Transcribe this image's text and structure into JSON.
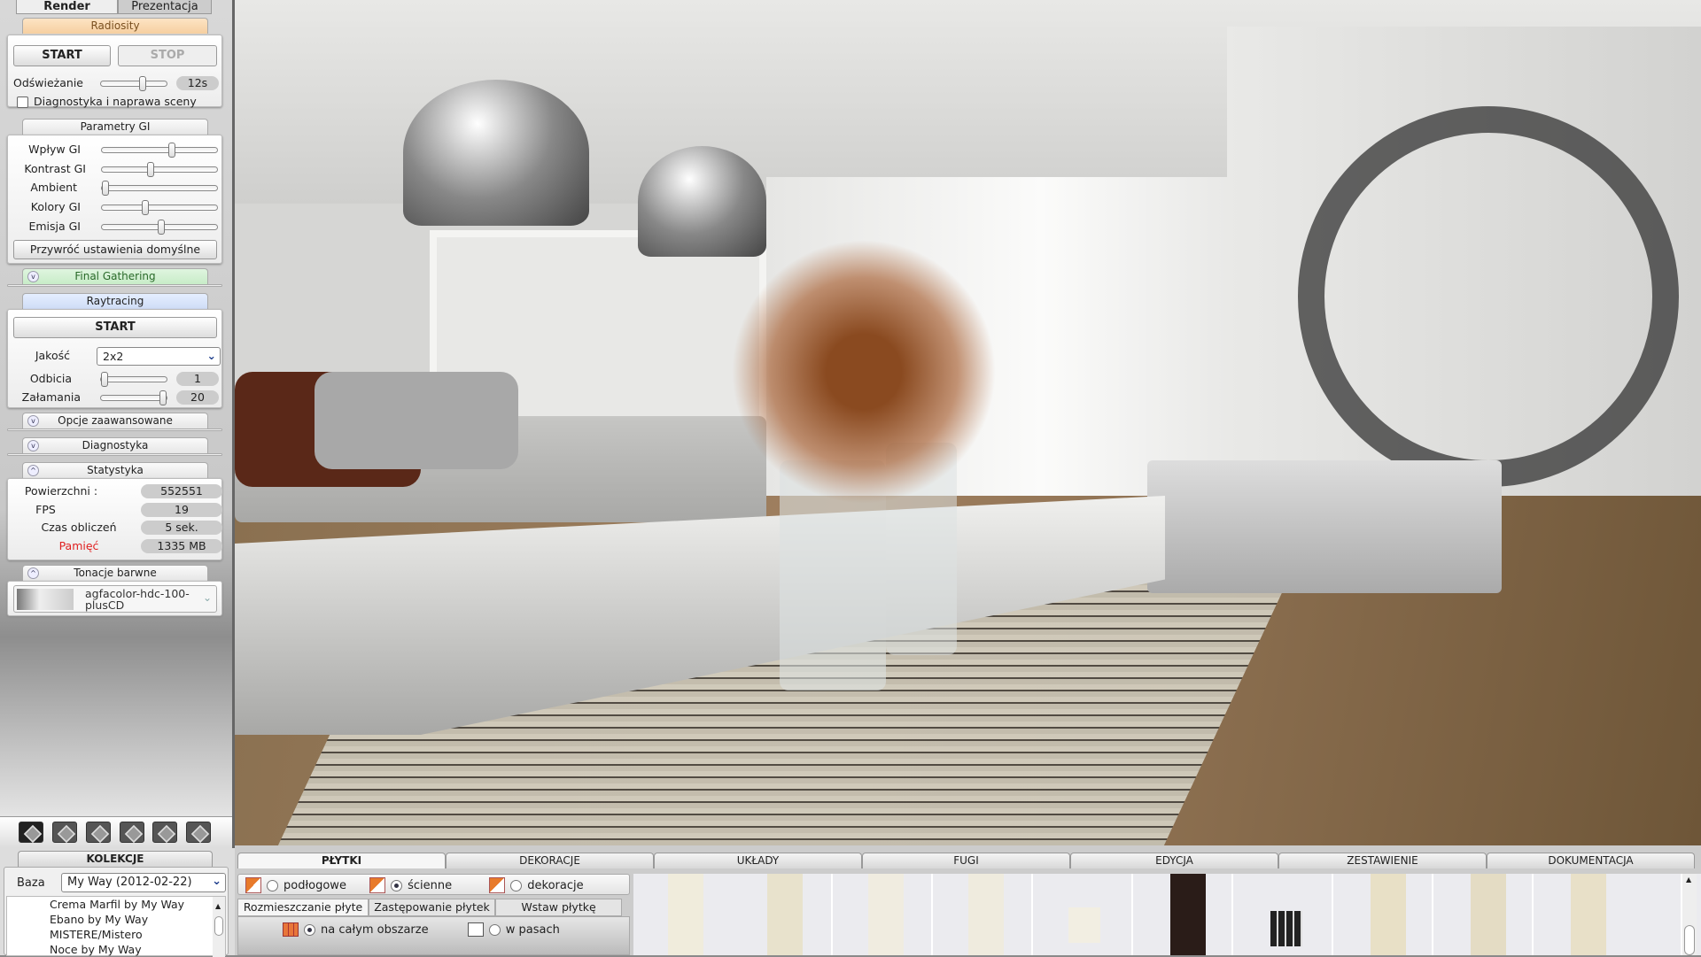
{
  "left_panel": {
    "tabs": [
      "Render",
      "Prezentacja"
    ],
    "radiosity": {
      "header": "Radiosity",
      "start": "START",
      "stop": "STOP",
      "refresh_label": "Odświeżanie",
      "refresh_value": "12s",
      "refresh_level": 0.6,
      "diag_checkbox": "Diagnostyka i naprawa sceny",
      "diag_checked": false
    },
    "gi": {
      "header": "Parametry GI",
      "sliders": [
        {
          "label": "Wpływ GI",
          "level": 0.6
        },
        {
          "label": "Kontrast GI",
          "level": 0.42
        },
        {
          "label": "Ambient",
          "level": 0.0
        },
        {
          "label": "Kolory GI",
          "level": 0.37
        },
        {
          "label": "Emisja GI",
          "level": 0.5
        }
      ],
      "restore": "Przywróć ustawienia domyślne"
    },
    "final_gathering": "Final Gathering",
    "raytracing": {
      "header": "Raytracing",
      "start": "START",
      "quality_label": "Jakość",
      "quality_value": "2x2",
      "reflections_label": "Odbicia",
      "reflections_value": "1",
      "reflections_level": 0.0,
      "refractions_label": "Załamania",
      "refractions_value": "20",
      "refractions_level": 1.0
    },
    "advanced": "Opcje zaawansowane",
    "diagnostics": "Diagnostyka",
    "stats": {
      "header": "Statystyka",
      "rows": [
        {
          "label": "Powierzchni :",
          "value": "552551"
        },
        {
          "label": "FPS",
          "value": "19"
        },
        {
          "label": "Czas obliczeń",
          "value": "5 sek."
        },
        {
          "label": "Pamięć",
          "value": "1335 MB"
        }
      ],
      "warn_color": "#e02020"
    },
    "tone": {
      "header": "Tonacje barwne",
      "value": "agfacolor-hdc-100-plusCD"
    },
    "view_icons": [
      "refresh-view-icon",
      "cube-view-front-icon",
      "cube-view-left-icon",
      "cube-view-right-icon",
      "cube-view-back-icon",
      "cube-view-top-icon"
    ],
    "accent": "#f0a020"
  },
  "collections": {
    "header": "KOLEKCJE",
    "base_label": "Baza",
    "base_value": "My Way (2012-02-22)",
    "items": [
      "Crema Marfil by My Way",
      "Ebano by My Way",
      "MISTERE/Mistero",
      "Noce by My Way"
    ]
  },
  "bottom": {
    "tabs": [
      "PŁYTKI",
      "DEKORACJE",
      "UKŁADY",
      "FUGI",
      "EDYCJA",
      "ZESTAWIENIE",
      "DOKUMENTACJA"
    ],
    "tile_types": [
      {
        "label": "podłogowe",
        "checked": false
      },
      {
        "label": "ścienne",
        "checked": true
      },
      {
        "label": "dekoracje",
        "checked": false
      }
    ],
    "subtabs": [
      "Rozmieszczanie płyte",
      "Zastępowanie płytek",
      "Wstaw płytkę"
    ],
    "placement": [
      {
        "label": "na całym obszarze",
        "checked": true
      },
      {
        "label": "w pasach",
        "checked": false
      }
    ]
  }
}
